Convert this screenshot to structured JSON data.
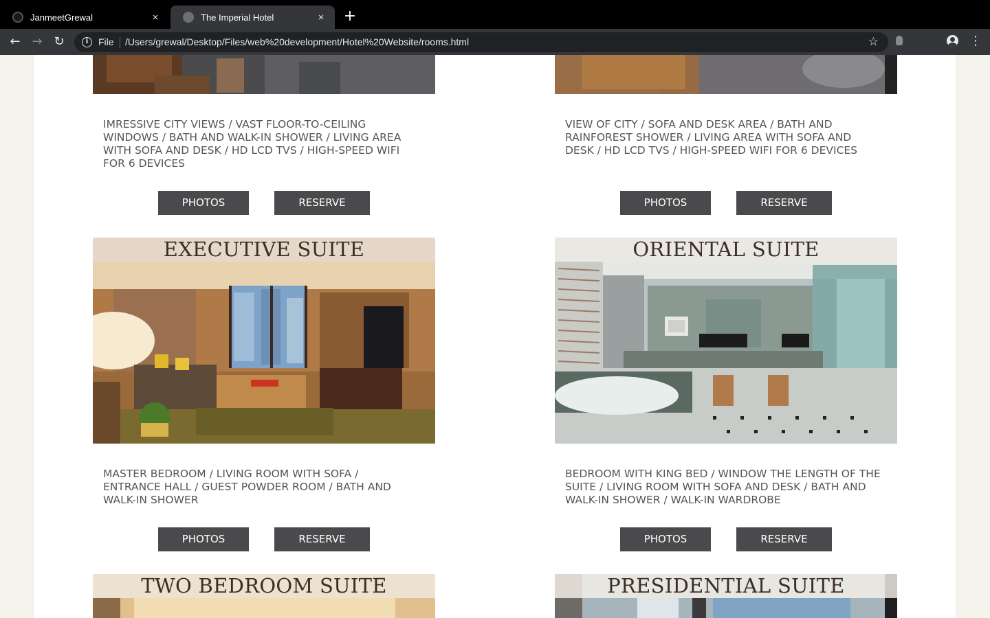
{
  "browser": {
    "tabs": [
      {
        "title": "JanmeetGrewal",
        "close": "×"
      },
      {
        "title": "The Imperial Hotel",
        "close": "×"
      }
    ],
    "new_tab": "+",
    "scheme_label": "File",
    "url": "/Users/grewal/Desktop/Files/web%20development/Hotel%20Website/rooms.html"
  },
  "rooms": [
    {
      "name": "",
      "features": "IMRESSIVE CITY VIEWS / VAST FLOOR-TO-CEILING WINDOWS / BATH AND WALK-IN SHOWER / LIVING AREA WITH SOFA AND DESK / HD LCD TVS / HIGH-SPEED WIFI FOR 6 DEVICES",
      "photos_label": "PHOTOS",
      "reserve_label": "RESERVE"
    },
    {
      "name": "",
      "features": "VIEW OF CITY / SOFA AND DESK AREA / BATH AND RAINFOREST SHOWER / LIVING AREA WITH SOFA AND DESK / HD LCD TVS / HIGH-SPEED WIFI FOR 6 DEVICES",
      "photos_label": "PHOTOS",
      "reserve_label": "RESERVE"
    },
    {
      "name": "EXECUTIVE SUITE",
      "features": "MASTER BEDROOM / LIVING ROOM WITH SOFA / ENTRANCE HALL / GUEST POWDER ROOM / BATH AND WALK-IN SHOWER",
      "photos_label": "PHOTOS",
      "reserve_label": "RESERVE"
    },
    {
      "name": "ORIENTAL SUITE",
      "features": "BEDROOM WITH KING BED / WINDOW THE LENGTH OF THE SUITE / LIVING ROOM WITH SOFA AND DESK / BATH AND WALK-IN SHOWER / WALK-IN WARDROBE",
      "photos_label": "PHOTOS",
      "reserve_label": "RESERVE"
    },
    {
      "name": "TWO BEDROOM SUITE",
      "features": "",
      "photos_label": "",
      "reserve_label": ""
    },
    {
      "name": "PRESIDENTIAL SUITE",
      "features": "",
      "photos_label": "",
      "reserve_label": ""
    }
  ],
  "colors": {
    "page_background": "#f4f4ec",
    "content_background": "#ffffff",
    "button_background": "#4a4a4c",
    "text": "#555555"
  }
}
